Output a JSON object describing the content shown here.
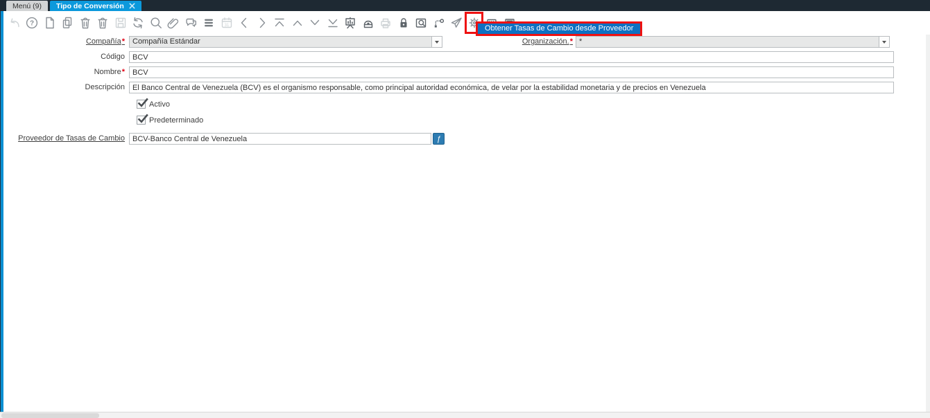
{
  "tabs": [
    {
      "label": "Menú (9)",
      "active": false
    },
    {
      "label": "Tipo de Conversión",
      "active": true,
      "closable": true
    }
  ],
  "toolbar": {
    "icons": [
      "undo",
      "help",
      "new-record",
      "copy-record",
      "delete-record",
      "delete-selection",
      "save",
      "refresh",
      "search",
      "attachment",
      "chat",
      "menu-lines",
      "calendar",
      "previous-record",
      "next-record",
      "first-record",
      "parent-record",
      "detail-record",
      "last-record",
      "report",
      "archive",
      "print",
      "lock",
      "record-info",
      "workflow",
      "send-mail",
      "process",
      "script",
      "window-customize"
    ],
    "highlighted_icon": "process",
    "highlight_color": "#ee1111"
  },
  "tooltip": {
    "text": "Obtener Tasas de Cambio desde Proveedor",
    "background": "#0e71c2"
  },
  "form": {
    "compania": {
      "label": "Compañía",
      "required": "*",
      "value": "Compañía Estándar"
    },
    "organizacion": {
      "label": "Organización.",
      "required": "*",
      "value": "*"
    },
    "codigo": {
      "label": "Código",
      "value": "BCV"
    },
    "nombre": {
      "label": "Nombre",
      "required": "*",
      "value": "BCV"
    },
    "descripcion": {
      "label": "Descripción",
      "value": "El Banco Central de Venezuela (BCV) es el organismo responsable, como principal autoridad económica, de velar por la estabilidad monetaria y de precios en Venezuela"
    },
    "activo": {
      "label": "Activo",
      "checked": true
    },
    "predeterminado": {
      "label": "Predeterminado",
      "checked": true
    },
    "proveedor": {
      "label": "Proveedor de Tasas de Cambio",
      "value": "BCV-Banco Central de Venezuela",
      "button_glyph": "ƒ"
    }
  },
  "colors": {
    "tabbar_bg": "#1e2933",
    "active_tab": "#0c99dc",
    "inactive_tab": "#d2d4d5",
    "accent_edge": "#0a8fd2",
    "readonly_field": "#e7e8e8",
    "zoom_button": "#2d7cb2",
    "required_mark": "#e00013",
    "highlight": "#ee1111"
  }
}
